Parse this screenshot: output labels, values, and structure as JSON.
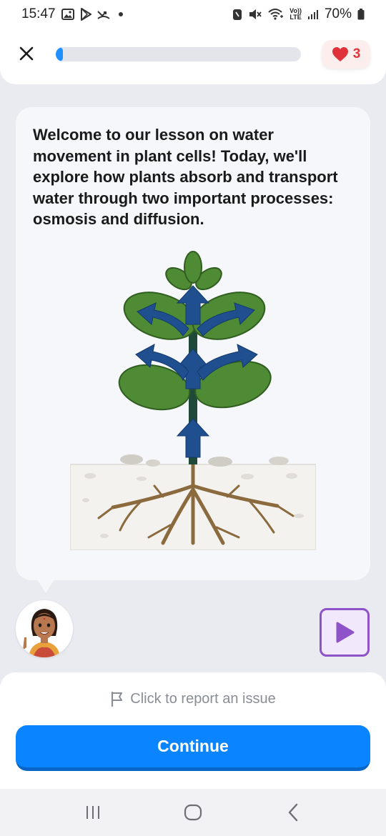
{
  "status_bar": {
    "time": "15:47",
    "battery": "70%",
    "left_icons": [
      "gallery-icon",
      "play-store-icon",
      "missed-call-icon"
    ],
    "right_icons": [
      "nfc-icon",
      "mute-icon",
      "wifi-calling-icon",
      "volte-icon",
      "signal-icon",
      "battery-icon"
    ],
    "volte_label_top": "Vo))",
    "volte_label_bottom": "LTE"
  },
  "header": {
    "close_icon": "close-icon",
    "progress": 0.03,
    "progress_color": "#1e90ff",
    "lives": "3",
    "lives_icon": "heart-icon",
    "lives_color": "#e0323a"
  },
  "lesson": {
    "text": "Welcome to our lesson on water movement in plant cells! Today, we'll explore how plants absorb and transport water through two important processes: osmosis and diffusion.",
    "illustration": "plant-water-transport-illustration"
  },
  "tutor": {
    "avatar": "tutor-avatar",
    "play_icon": "play-icon",
    "accent_color": "#8e52c9"
  },
  "footer": {
    "report_label": "Click to report an issue",
    "report_icon": "flag-icon",
    "continue_label": "Continue",
    "continue_color": "#0a84ff"
  },
  "nav": {
    "items": [
      "recent-apps-icon",
      "home-icon",
      "back-icon"
    ]
  }
}
